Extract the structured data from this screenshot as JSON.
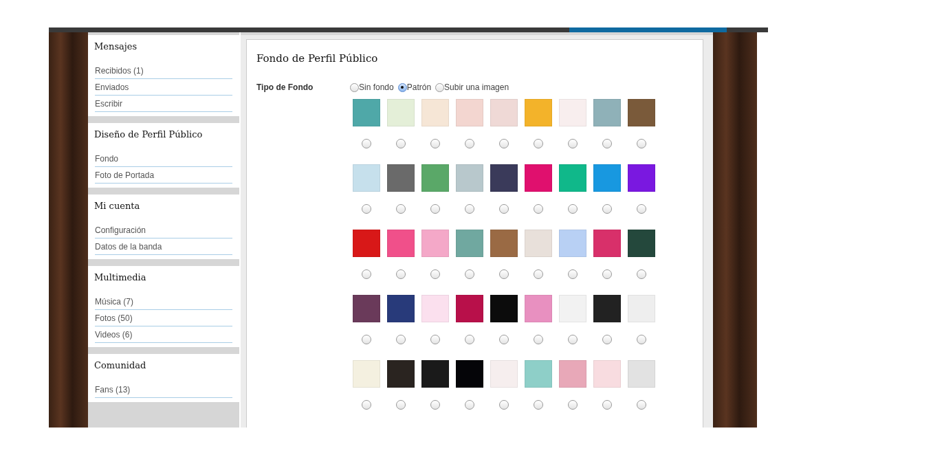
{
  "sidebar": [
    {
      "title": "Mensajes",
      "items": [
        "Recibidos (1)",
        "Enviados",
        "Escribir"
      ]
    },
    {
      "title": "Diseño de Perfil Público",
      "items": [
        "Fondo",
        "Foto de Portada"
      ]
    },
    {
      "title": "Mi cuenta",
      "items": [
        "Configuración",
        "Datos de la banda"
      ]
    },
    {
      "title": "Multimedia",
      "items": [
        "Música (7)",
        "Fotos (50)",
        "Videos (6)"
      ]
    },
    {
      "title": "Comunidad",
      "items": [
        "Fans (13)"
      ]
    }
  ],
  "main": {
    "title": "Fondo de Perfil Público",
    "field_label": "Tipo de Fondo",
    "options": [
      {
        "label": "Sin fondo",
        "selected": false
      },
      {
        "label": "Patrón",
        "selected": true
      },
      {
        "label": "Subir una imagen",
        "selected": false
      }
    ],
    "patterns": [
      {
        "color": "#4fa8a8",
        "selected": false
      },
      {
        "color": "#e4efd8",
        "selected": false
      },
      {
        "color": "#f6e6d6",
        "selected": false
      },
      {
        "color": "#f3d6d0",
        "selected": false
      },
      {
        "color": "#efd9d6",
        "selected": false
      },
      {
        "color": "#f3b32a",
        "selected": false
      },
      {
        "color": "#f8eeee",
        "selected": false
      },
      {
        "color": "#8fb1b8",
        "selected": false
      },
      {
        "color": "#7a5a3a",
        "selected": false
      },
      {
        "color": "#c6e0ec",
        "selected": false
      },
      {
        "color": "#6a6a6a",
        "selected": false
      },
      {
        "color": "#5aa868",
        "selected": false
      },
      {
        "color": "#b8c8cc",
        "selected": false
      },
      {
        "color": "#3a3a5a",
        "selected": false
      },
      {
        "color": "#e0106e",
        "selected": false
      },
      {
        "color": "#10b88a",
        "selected": false
      },
      {
        "color": "#1898e0",
        "selected": false
      },
      {
        "color": "#7a18e0",
        "selected": false
      },
      {
        "color": "#d81818",
        "selected": false
      },
      {
        "color": "#f0508a",
        "selected": false
      },
      {
        "color": "#f4a8c8",
        "selected": false
      },
      {
        "color": "#70a8a0",
        "selected": false
      },
      {
        "color": "#9a6a44",
        "selected": false
      },
      {
        "color": "#e8e0da",
        "selected": false
      },
      {
        "color": "#b8d0f4",
        "selected": false
      },
      {
        "color": "#d8306a",
        "selected": false
      },
      {
        "color": "#24483c",
        "selected": false
      },
      {
        "color": "#6a3a5a",
        "selected": false
      },
      {
        "color": "#283a7a",
        "selected": false
      },
      {
        "color": "#fbe0ee",
        "selected": false
      },
      {
        "color": "#b8104a",
        "selected": false
      },
      {
        "color": "#0c0c0c",
        "selected": false
      },
      {
        "color": "#e890c0",
        "selected": false
      },
      {
        "color": "#f2f2f2",
        "selected": false
      },
      {
        "color": "#222222",
        "selected": false
      },
      {
        "color": "#eeeeee",
        "selected": false
      },
      {
        "color": "#f4f0e0",
        "selected": false
      },
      {
        "color": "#2a2420",
        "selected": false
      },
      {
        "color": "#1a1a1a",
        "selected": false
      },
      {
        "color": "#050508",
        "selected": false
      },
      {
        "color": "#f6eeee",
        "selected": false
      },
      {
        "color": "#8ecfc8",
        "selected": false
      },
      {
        "color": "#e8a8b8",
        "selected": false
      },
      {
        "color": "#f8dce0",
        "selected": false
      },
      {
        "color": "#e2e2e2",
        "selected": false
      }
    ]
  }
}
